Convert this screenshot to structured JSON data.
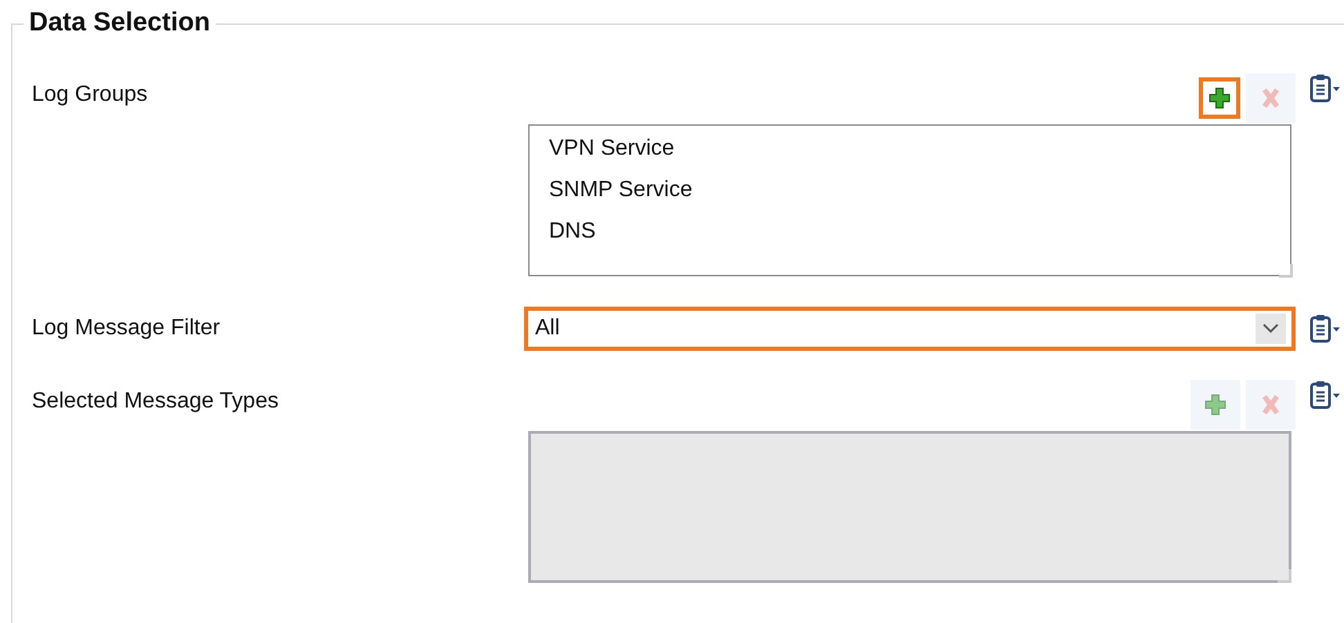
{
  "group_title": "Data Selection",
  "fields": [
    {
      "kind": "list",
      "label": "Log Groups",
      "add_disabled": false,
      "add_focused": true,
      "remove_disabled": true,
      "disabled": false,
      "items": [
        "VPN Service",
        "SNMP Service",
        "DNS"
      ]
    },
    {
      "kind": "combo",
      "label": "Log Message Filter",
      "value": "All",
      "focused": true
    },
    {
      "kind": "list",
      "label": "Selected Message Types",
      "add_disabled": true,
      "add_focused": false,
      "remove_disabled": true,
      "disabled": true
    }
  ]
}
